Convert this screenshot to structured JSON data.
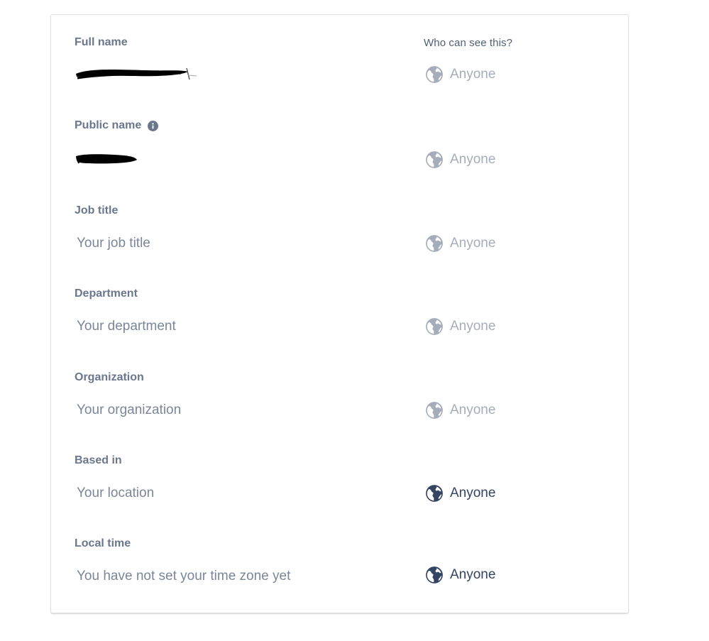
{
  "header": {
    "who_can_see": "Who can see this?"
  },
  "fields": [
    {
      "label": "Full name",
      "value": "",
      "visibility": "Anyone",
      "visibility_state": "disabled"
    },
    {
      "label": "Public name",
      "value": "",
      "visibility": "Anyone",
      "visibility_state": "disabled"
    },
    {
      "label": "Job title",
      "placeholder": "Your job title",
      "visibility": "Anyone",
      "visibility_state": "disabled"
    },
    {
      "label": "Department",
      "placeholder": "Your department",
      "visibility": "Anyone",
      "visibility_state": "disabled"
    },
    {
      "label": "Organization",
      "placeholder": "Your organization",
      "visibility": "Anyone",
      "visibility_state": "disabled"
    },
    {
      "label": "Based in",
      "placeholder": "Your location",
      "visibility": "Anyone",
      "visibility_state": "enabled"
    },
    {
      "label": "Local time",
      "placeholder": "You have not set your time zone yet",
      "visibility": "Anyone",
      "visibility_state": "enabled"
    }
  ],
  "icons": {
    "visibility_icon": "globe-icon",
    "info_icon": "info-icon"
  },
  "colors": {
    "label": "#6b778c",
    "placeholder": "#7a869a",
    "visibility_disabled": "#a5adba",
    "visibility_enabled": "#344563",
    "card_border": "#dfe1e6"
  }
}
